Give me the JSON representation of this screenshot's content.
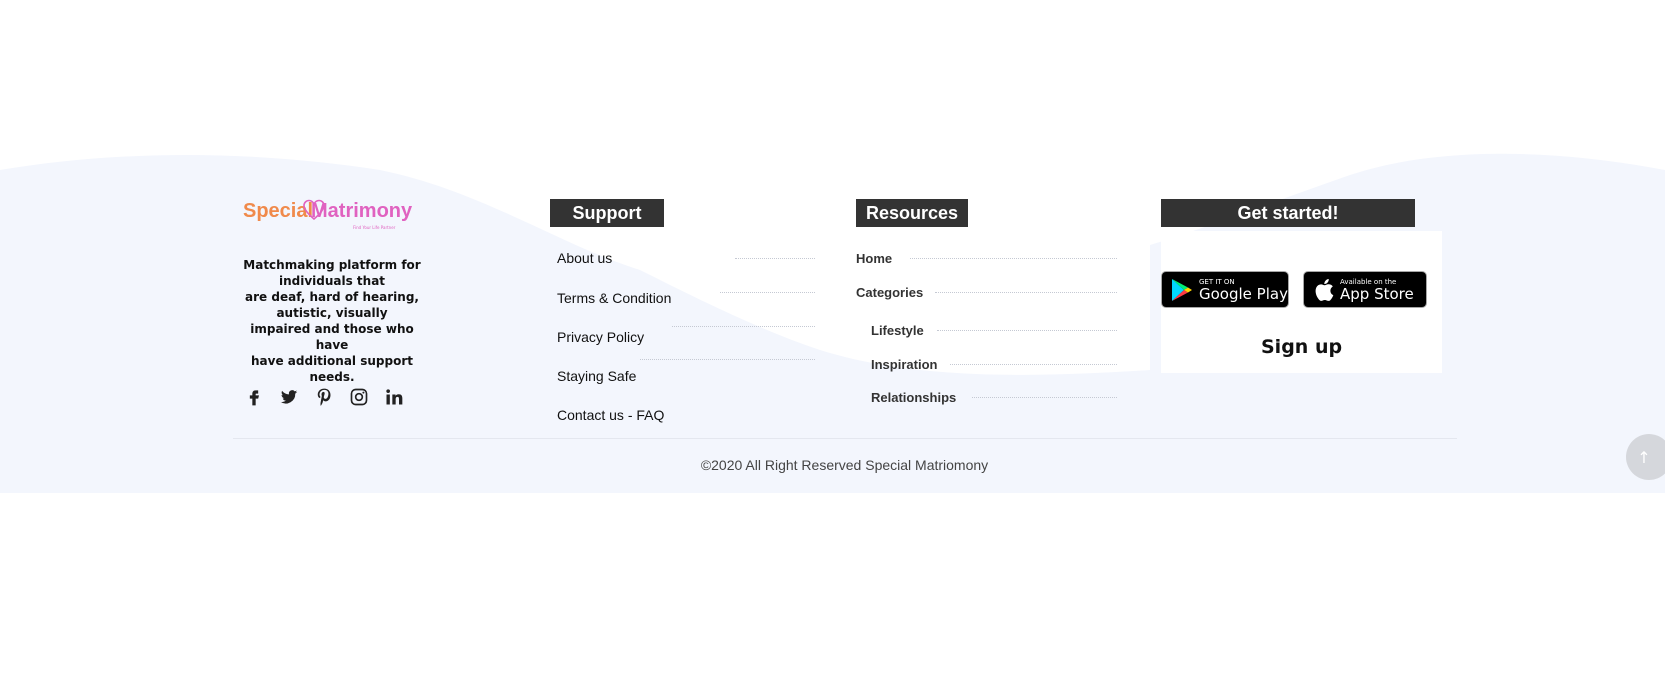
{
  "brand": {
    "logo_part1": "Special",
    "logo_part2": "Matrimony",
    "logo_tagline": "Find Your Life Partner",
    "tagline_lines": [
      "Matchmaking platform for",
      "individuals that",
      "are deaf, hard of hearing,",
      "autistic, visually",
      "impaired and those who have",
      "have additional support needs."
    ],
    "social_icons": [
      "facebook-icon",
      "twitter-icon",
      "pinterest-icon",
      "instagram-icon",
      "linkedin-icon"
    ]
  },
  "support": {
    "heading": "Support",
    "links": [
      "About us",
      "Terms & Condition",
      "Privacy Policy",
      "Staying Safe",
      "Contact us - FAQ"
    ]
  },
  "resources": {
    "heading": "Resources",
    "links": [
      "Home",
      "Categories"
    ],
    "sub_links": [
      "Lifestyle",
      "Inspiration",
      "Relationships"
    ]
  },
  "get_started": {
    "heading": "Get started!",
    "google_play": {
      "small": "GET IT ON",
      "big": "Google Play"
    },
    "app_store": {
      "small": "Available on the",
      "big": "App Store"
    },
    "signup": "Sign up"
  },
  "footer": {
    "copyright": "©2020 All Right Reserved Special Matriomony"
  },
  "colors": {
    "footer_bg": "#f3f6fd",
    "heading_bg": "#333333",
    "logo_orange": "#f08a4b",
    "logo_pink": "#e062c0"
  },
  "icons": {
    "back_to_top": "arrow-up-icon"
  }
}
